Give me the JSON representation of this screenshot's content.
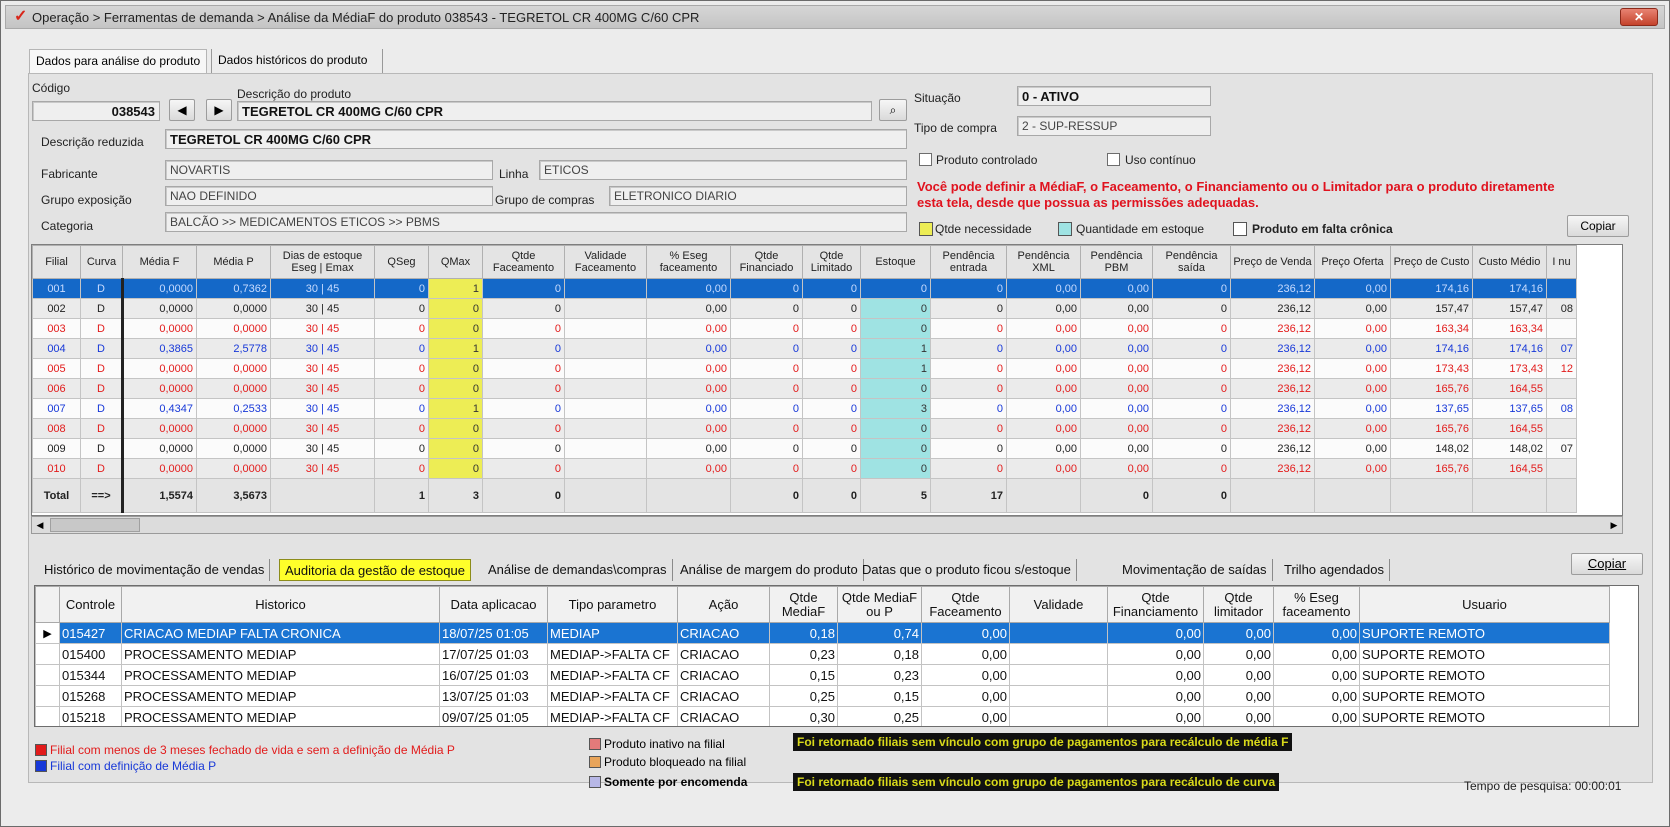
{
  "window": {
    "title": "Operação > Ferramentas de demanda > Análise da MédiaF do produto 038543 - TEGRETOL CR 400MG C/60 CPR",
    "close_glyph": "✕"
  },
  "top_tabs": [
    "Dados para análise do produto",
    "Dados históricos do produto"
  ],
  "form": {
    "codigo_label": "Código",
    "codigo_value": "038543",
    "descricao_label": "Descrição do produto",
    "descricao_value": "TEGRETOL CR 400MG C/60 CPR",
    "desc_reduzida_label": "Descrição reduzida",
    "desc_reduzida_value": "TEGRETOL CR 400MG C/60 CPR",
    "fabricante_label": "Fabricante",
    "fabricante_value": "NOVARTIS",
    "linha_label": "Linha",
    "linha_value": "ETICOS",
    "grupo_exposicao_label": "Grupo exposição",
    "grupo_exposicao_value": "NAO DEFINIDO",
    "grupo_compras_label": "Grupo de compras",
    "grupo_compras_value": "ELETRONICO DIARIO",
    "categoria_label": "Categoria",
    "categoria_value": "BALCÃO >> MEDICAMENTOS ETICOS >> PBMS",
    "situacao_label": "Situação",
    "situacao_value": "0 - ATIVO",
    "tipo_compra_label": "Tipo de compra",
    "tipo_compra_value": "2 - SUP-RESSUP",
    "produto_controlado_label": "Produto controlado",
    "uso_continuo_label": "Uso contínuo",
    "warning_line1": "Você pode definir a MédiaF, o Faceamento, o Financiamento ou o Limitador para o produto diretamente",
    "warning_line2": "esta tela, desde que possua as permissões adequadas.",
    "legend_qtde_necessidade": "Qtde necessidade",
    "legend_quantidade_estoque": "Quantidade em estoque",
    "legend_falta_cronica": "Produto em falta crônica",
    "copiar_label": "Copiar",
    "colors": {
      "yellow": "#eded55",
      "cyan": "#9fe3e3",
      "white": "#ffffff"
    }
  },
  "grid1": {
    "headers": [
      "Filial",
      "Curva",
      "Média F",
      "Média P",
      "Dias de estoque Eseg | Emax",
      "QSeg",
      "QMax",
      "Qtde Faceamento",
      "Validade Faceamento",
      "% Eseg faceamento",
      "Qtde Financiado",
      "Qtde Limitado",
      "Estoque",
      "Pendência entrada",
      "Pendência XML",
      "Pendência PBM",
      "Pendência saída",
      "Preço de Venda",
      "Preço Oferta",
      "Preço de Custo",
      "Custo Médio",
      "I nu"
    ],
    "rows": [
      {
        "style": "selected",
        "cells": [
          "001",
          "D",
          "0,0000",
          "0,7362",
          "30 | 45",
          "0",
          "1",
          "0",
          "",
          "0,00",
          "0",
          "0",
          "0",
          "0",
          "0,00",
          "0,00",
          "0",
          "236,12",
          "0,00",
          "174,16",
          "174,16",
          ""
        ]
      },
      {
        "style": "black",
        "cells": [
          "002",
          "D",
          "0,0000",
          "0,0000",
          "30 | 45",
          "0",
          "0",
          "0",
          "",
          "0,00",
          "0",
          "0",
          "0",
          "0",
          "0,00",
          "0,00",
          "0",
          "236,12",
          "0,00",
          "157,47",
          "157,47",
          "08"
        ]
      },
      {
        "style": "red",
        "cells": [
          "003",
          "D",
          "0,0000",
          "0,0000",
          "30 | 45",
          "0",
          "0",
          "0",
          "",
          "0,00",
          "0",
          "0",
          "0",
          "0",
          "0,00",
          "0,00",
          "0",
          "236,12",
          "0,00",
          "163,34",
          "163,34",
          ""
        ]
      },
      {
        "style": "blue",
        "cells": [
          "004",
          "D",
          "0,3865",
          "2,5778",
          "30 | 45",
          "0",
          "1",
          "0",
          "",
          "0,00",
          "0",
          "0",
          "1",
          "0",
          "0,00",
          "0,00",
          "0",
          "236,12",
          "0,00",
          "174,16",
          "174,16",
          "07"
        ]
      },
      {
        "style": "red",
        "cells": [
          "005",
          "D",
          "0,0000",
          "0,0000",
          "30 | 45",
          "0",
          "0",
          "0",
          "",
          "0,00",
          "0",
          "0",
          "1",
          "0",
          "0,00",
          "0,00",
          "0",
          "236,12",
          "0,00",
          "173,43",
          "173,43",
          "12"
        ]
      },
      {
        "style": "red",
        "cells": [
          "006",
          "D",
          "0,0000",
          "0,0000",
          "30 | 45",
          "0",
          "0",
          "0",
          "",
          "0,00",
          "0",
          "0",
          "0",
          "0",
          "0,00",
          "0,00",
          "0",
          "236,12",
          "0,00",
          "165,76",
          "164,55",
          ""
        ]
      },
      {
        "style": "blue",
        "cells": [
          "007",
          "D",
          "0,4347",
          "0,2533",
          "30 | 45",
          "0",
          "1",
          "0",
          "",
          "0,00",
          "0",
          "0",
          "3",
          "0",
          "0,00",
          "0,00",
          "0",
          "236,12",
          "0,00",
          "137,65",
          "137,65",
          "08"
        ]
      },
      {
        "style": "red",
        "cells": [
          "008",
          "D",
          "0,0000",
          "0,0000",
          "30 | 45",
          "0",
          "0",
          "0",
          "",
          "0,00",
          "0",
          "0",
          "0",
          "0",
          "0,00",
          "0,00",
          "0",
          "236,12",
          "0,00",
          "165,76",
          "164,55",
          ""
        ]
      },
      {
        "style": "black",
        "cells": [
          "009",
          "D",
          "0,0000",
          "0,0000",
          "30 | 45",
          "0",
          "0",
          "0",
          "",
          "0,00",
          "0",
          "0",
          "0",
          "0",
          "0,00",
          "0,00",
          "0",
          "236,12",
          "0,00",
          "148,02",
          "148,02",
          "07"
        ]
      },
      {
        "style": "red",
        "cells": [
          "010",
          "D",
          "0,0000",
          "0,0000",
          "30 | 45",
          "0",
          "0",
          "0",
          "",
          "0,00",
          "0",
          "0",
          "0",
          "0",
          "0,00",
          "0,00",
          "0",
          "236,12",
          "0,00",
          "165,76",
          "164,55",
          ""
        ]
      }
    ],
    "total": [
      "Total",
      "==>",
      "1,5574",
      "3,5673",
      "",
      "1",
      "3",
      "0",
      "",
      "",
      "0",
      "0",
      "5",
      "17",
      "",
      "0",
      "0",
      "",
      "",
      "",
      "",
      ""
    ]
  },
  "bottom_tabs": [
    "Histórico de movimentação de vendas",
    "Auditoria da gestão de estoque",
    "Análise de demandas\\compras",
    "Análise de margem do produto",
    "Datas que o produto ficou s/estoque",
    "Movimentação de saídas",
    "Trilho agendados"
  ],
  "bottom_copiar": "Copiar",
  "grid2": {
    "headers": [
      "",
      "Controle",
      "Historico",
      "Data aplicacao",
      "Tipo parametro",
      "Ação",
      "Qtde MediaF",
      "Qtde MediaF ou P",
      "Qtde Faceamento",
      "Validade",
      "Qtde Financiamento",
      "Qtde limitador",
      "% Eseg faceamento",
      "Usuario"
    ],
    "rows": [
      [
        "▶",
        "015427",
        "CRIACAO MEDIAP FALTA CRONICA",
        "18/07/25 01:05",
        "MEDIAP",
        "CRIACAO",
        "0,18",
        "0,74",
        "0,00",
        "",
        "0,00",
        "0,00",
        "0,00",
        "SUPORTE REMOTO"
      ],
      [
        "",
        "015400",
        "PROCESSAMENTO MEDIAP",
        "17/07/25 01:03",
        "MEDIAP->FALTA CF",
        "CRIACAO",
        "0,23",
        "0,18",
        "0,00",
        "",
        "0,00",
        "0,00",
        "0,00",
        "SUPORTE REMOTO"
      ],
      [
        "",
        "015344",
        "PROCESSAMENTO MEDIAP",
        "16/07/25 01:03",
        "MEDIAP->FALTA CF",
        "CRIACAO",
        "0,15",
        "0,23",
        "0,00",
        "",
        "0,00",
        "0,00",
        "0,00",
        "SUPORTE REMOTO"
      ],
      [
        "",
        "015268",
        "PROCESSAMENTO MEDIAP",
        "13/07/25 01:03",
        "MEDIAP->FALTA CF",
        "CRIACAO",
        "0,25",
        "0,15",
        "0,00",
        "",
        "0,00",
        "0,00",
        "0,00",
        "SUPORTE REMOTO"
      ],
      [
        "",
        "015218",
        "PROCESSAMENTO MEDIAP",
        "09/07/25 01:05",
        "MEDIAP->FALTA CF",
        "CRIACAO",
        "0,30",
        "0,25",
        "0,00",
        "",
        "0,00",
        "0,00",
        "0,00",
        "SUPORTE REMOTO"
      ]
    ]
  },
  "footer": {
    "legend_red": "Filial com menos de 3 meses fechado de vida e sem a definição de Média P",
    "legend_blue": "Filial com definição de Média P",
    "produto_inativo": "Produto inativo na filial",
    "produto_bloqueado": "Produto bloqueado na filial",
    "somente_encomenda": "Somente por encomenda",
    "black_msg1": "Foi retornado filiais sem vínculo com grupo de pagamentos para recálculo de média F",
    "black_msg2": "Foi retornado filiais sem vínculo com grupo de pagamentos para recálculo de curva",
    "tempo_pesquisa": "Tempo de pesquisa: 00:00:01",
    "colors": {
      "red": "#e21b1b",
      "blue": "#1738d8",
      "inativo": "#e37a7a",
      "bloqueado": "#e8a45a",
      "encomenda": "#b7b7e6"
    }
  }
}
